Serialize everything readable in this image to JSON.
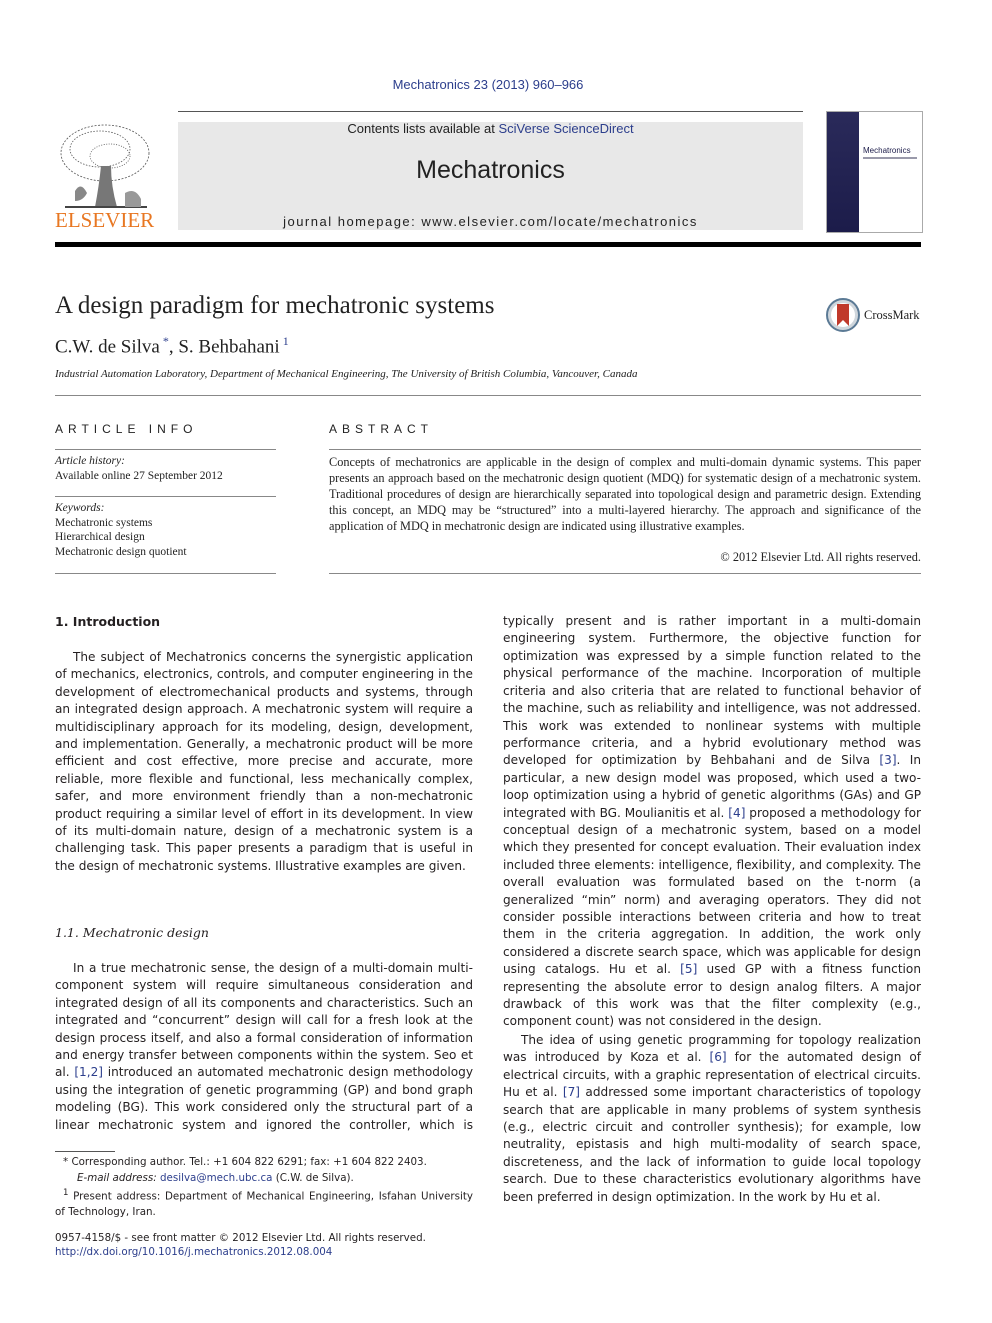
{
  "header": {
    "citation": "Mechatronics 23 (2013) 960–966",
    "contents_prefix": "Contents lists available at ",
    "contents_link": "SciVerse ScienceDirect",
    "journal_title": "Mechatronics",
    "homepage_prefix": "journal homepage: ",
    "homepage_url": "www.elsevier.com/locate/mechatronics",
    "publisher_logo_text": "ELSEVIER",
    "cover_title": "Mechatronics",
    "brand_color": "#e87722",
    "link_color": "#2c3e8c"
  },
  "article": {
    "title": "A design paradigm for mechatronic systems",
    "authors": [
      {
        "name": "C.W. de Silva",
        "mark": "*"
      },
      {
        "name": "S. Behbahani",
        "mark": "1"
      }
    ],
    "author_separator": ", ",
    "affiliation": "Industrial Automation Laboratory, Department of Mechanical Engineering, The University of British Columbia, Vancouver, Canada",
    "crossmark_label": "CrossMark"
  },
  "article_info": {
    "heading": "ARTICLE INFO",
    "history_label": "Article history:",
    "history_value": "Available online 27 September 2012",
    "keywords_label": "Keywords:",
    "keywords": [
      "Mechatronic systems",
      "Hierarchical design",
      "Mechatronic design quotient"
    ]
  },
  "abstract": {
    "heading": "ABSTRACT",
    "text": "Concepts of mechatronics are applicable in the design of complex and multi-domain dynamic systems. This paper presents an approach based on the mechatronic design quotient (MDQ) for systematic design of a mechatronic system. Traditional procedures of design are hierarchically separated into topological design and parametric design. Extending this concept, an MDQ may be “structured” into a multi-layered hierarchy. The approach and significance of the application of MDQ in mechatronic design are indicated using illustrative examples.",
    "copyright": "© 2012 Elsevier Ltd. All rights reserved."
  },
  "body": {
    "section1_heading": "1. Introduction",
    "section1_para1": "The subject of Mechatronics concerns the synergistic application of mechanics, electronics, controls, and computer engineering in the development of electromechanical products and systems, through an integrated design approach. A mechatronic system will require a multidisciplinary approach for its modeling, design, development, and implementation. Generally, a mechatronic product will be more efficient and cost effective, more precise and accurate, more reliable, more flexible and functional, less mechanically complex, safer, and more environment friendly than a non-mechatronic product requiring a similar level of effort in its development. In view of its multi-domain nature, design of a mechatronic system is a challenging task. This paper presents a paradigm that is useful in the design of mechatronic systems. Illustrative examples are given.",
    "section11_heading": "1.1. Mechatronic design",
    "section11_para1_a": "In a true mechatronic sense, the design of a multi-domain multi-component system will require simultaneous consideration and integrated design of all its components and characteristics. Such an integrated and “concurrent” design will call for a fresh look at the design process itself, and also a formal consideration of information and energy transfer between components within the system. Seo et al. ",
    "ref_1_2": "[1,2]",
    "section11_para1_b": " introduced an automated mechatronic design methodology using the integration of genetic programming (GP) and bond graph modeling (BG). This work considered only the structural part of a linear mechatronic system and ignored the controller, which is typically present and is rather important in a multi-domain engineering system. Furthermore, the objective function for optimization was expressed by a simple function related to the physical performance of the machine. Incorporation of multiple criteria and also criteria that are related to functional behavior of the machine, such as reliability and intelligence, was not addressed. This work was extended to nonlinear systems with multiple performance criteria, and a hybrid evolutionary method was developed for optimization by Behbahani and de Silva ",
    "ref_3": "[3]",
    "section11_para1_c": ". In particular, a new design model was proposed, which used a two-loop optimization using a hybrid of genetic algorithms (GAs) and GP integrated with BG. Moulianitis et al. ",
    "ref_4": "[4]",
    "section11_para1_d": " proposed a methodology for conceptual design of a mechatronic system, based on a model which they presented for concept evaluation. Their evaluation index included three elements: intelligence, flexibility, and complexity. The overall evaluation was formulated based on the t-norm (a generalized “min” norm) and averaging operators. They did not consider possible interactions between criteria and how to treat them in the criteria aggregation. In addition, the work only considered a discrete search space, which was applicable for design using catalogs. Hu et al. ",
    "ref_5": "[5]",
    "section11_para1_e": " used GP with a fitness function representing the absolute error to design analog filters. A major drawback of this work was that the filter complexity (e.g., component count) was not considered in the design.",
    "para2_a": "The idea of using genetic programming for topology realization was introduced by Koza et al. ",
    "ref_6": "[6]",
    "para2_b": " for the automated design of electrical circuits, with a graphic representation of electrical circuits. Hu et al. ",
    "ref_7": "[7]",
    "para2_c": " addressed some important characteristics of topology search that are applicable in many problems of system synthesis (e.g., electric circuit and controller synthesis); for example, low neutrality, epistasis and high multi-modality of search space, discreteness, and the lack of information to guide local topology search. Due to these characteristics evolutionary algorithms have been preferred in design optimization. In the work by Hu et al."
  },
  "footnotes": {
    "corresponding": "Corresponding author. Tel.: +1 604 822 6291; fax: +1 604 822 2403.",
    "corresponding_mark": "*",
    "email_label": "E-mail address: ",
    "email": "desilva@mech.ubc.ca",
    "email_suffix": " (C.W. de Silva).",
    "present_mark": "1",
    "present_address": "Present address: Department of Mechanical Engineering, Isfahan University of Technology, Iran."
  },
  "front_matter": {
    "issn_line": "0957-4158/$ - see front matter © 2012 Elsevier Ltd. All rights reserved.",
    "doi": "http://dx.doi.org/10.1016/j.mechatronics.2012.08.004"
  }
}
